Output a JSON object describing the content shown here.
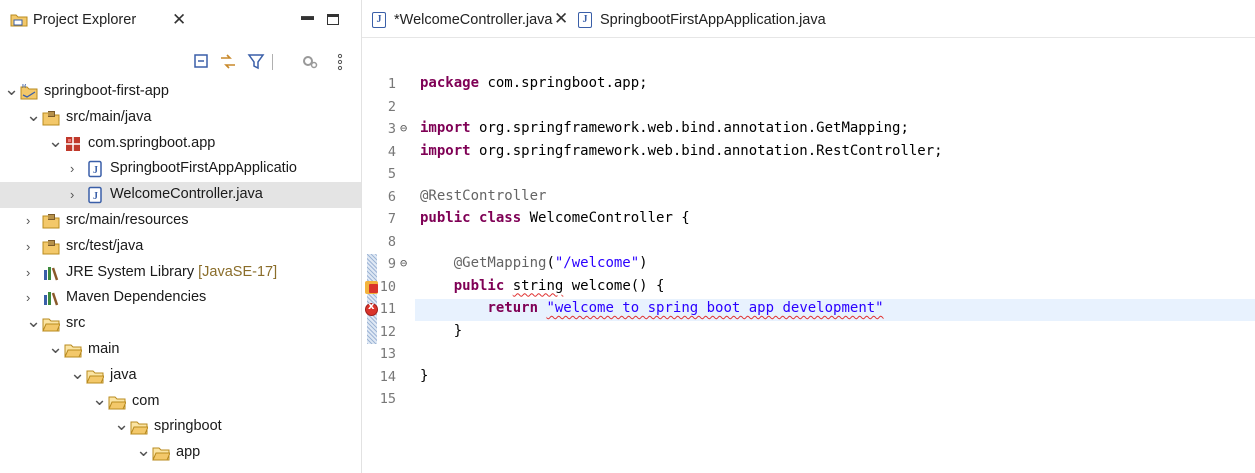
{
  "project_explorer": {
    "tab_title": "Project Explorer",
    "tree": [
      {
        "label": "springboot-first-app",
        "level": 0,
        "expanded": true,
        "icon": "project-icon"
      },
      {
        "label": "src/main/java",
        "level": 1,
        "expanded": true,
        "icon": "source-folder-icon"
      },
      {
        "label": "com.springboot.app",
        "level": 2,
        "expanded": true,
        "icon": "package-icon"
      },
      {
        "label": "SpringbootFirstAppApplicatio",
        "level": 3,
        "expanded": false,
        "icon": "java-file-icon"
      },
      {
        "label": "WelcomeController.java",
        "level": 3,
        "expanded": false,
        "icon": "java-file-icon",
        "selected": true
      },
      {
        "label": "src/main/resources",
        "level": 1,
        "expanded": false,
        "icon": "source-folder-icon"
      },
      {
        "label": "src/test/java",
        "level": 1,
        "expanded": false,
        "icon": "source-folder-icon"
      },
      {
        "label": "JRE System Library",
        "decoration": "[JavaSE-17]",
        "level": 1,
        "expanded": false,
        "icon": "library-icon"
      },
      {
        "label": "Maven Dependencies",
        "level": 1,
        "expanded": false,
        "icon": "library-icon"
      },
      {
        "label": "src",
        "level": 1,
        "expanded": true,
        "icon": "folder-icon"
      },
      {
        "label": "main",
        "level": 2,
        "expanded": true,
        "icon": "folder-icon"
      },
      {
        "label": "java",
        "level": 3,
        "expanded": true,
        "icon": "folder-icon"
      },
      {
        "label": "com",
        "level": 4,
        "expanded": true,
        "icon": "folder-icon"
      },
      {
        "label": "springboot",
        "level": 5,
        "expanded": true,
        "icon": "folder-icon"
      },
      {
        "label": "app",
        "level": 6,
        "expanded": true,
        "icon": "folder-icon"
      }
    ]
  },
  "editor": {
    "tabs": [
      {
        "label": "*WelcomeController.java",
        "active": true,
        "closable": true
      },
      {
        "label": "SpringbootFirstAppApplication.java",
        "active": false,
        "closable": false
      }
    ],
    "lines": [
      {
        "n": "1",
        "tokens": [
          {
            "t": "package ",
            "c": "kw"
          },
          {
            "t": "com.springboot.app;"
          }
        ]
      },
      {
        "n": "2",
        "tokens": []
      },
      {
        "n": "3",
        "fold": true,
        "tokens": [
          {
            "t": "import ",
            "c": "kw"
          },
          {
            "t": "org.springframework.web.bind.annotation.GetMapping;"
          }
        ]
      },
      {
        "n": "4",
        "tokens": [
          {
            "t": "import ",
            "c": "kw"
          },
          {
            "t": "org.springframework.web.bind.annotation.RestController;"
          }
        ]
      },
      {
        "n": "5",
        "tokens": []
      },
      {
        "n": "6",
        "tokens": [
          {
            "t": "@RestController",
            "c": "ann"
          }
        ]
      },
      {
        "n": "7",
        "tokens": [
          {
            "t": "public ",
            "c": "kw"
          },
          {
            "t": "class ",
            "c": "kw"
          },
          {
            "t": "WelcomeController {"
          }
        ]
      },
      {
        "n": "8",
        "tokens": []
      },
      {
        "n": "9",
        "fold": true,
        "tokens": [
          {
            "t": "    "
          },
          {
            "t": "@GetMapping",
            "c": "ann"
          },
          {
            "t": "("
          },
          {
            "t": "\"/welcome\"",
            "c": "str"
          },
          {
            "t": ")"
          }
        ]
      },
      {
        "n": "10",
        "marker": "error-warning",
        "tokens": [
          {
            "t": "    "
          },
          {
            "t": "public ",
            "c": "kw"
          },
          {
            "t": "string",
            "c": "squig"
          },
          {
            "t": " welcome() {"
          }
        ]
      },
      {
        "n": "11",
        "marker": "error",
        "current": true,
        "tokens": [
          {
            "t": "        "
          },
          {
            "t": "return ",
            "c": "kw"
          },
          {
            "t": "\"welcome to spring boot app development\"",
            "c": "str squig"
          }
        ]
      },
      {
        "n": "12",
        "tokens": [
          {
            "t": "    }"
          }
        ]
      },
      {
        "n": "13",
        "tokens": []
      },
      {
        "n": "14",
        "tokens": [
          {
            "t": "}"
          }
        ]
      },
      {
        "n": "15",
        "tokens": []
      }
    ]
  }
}
